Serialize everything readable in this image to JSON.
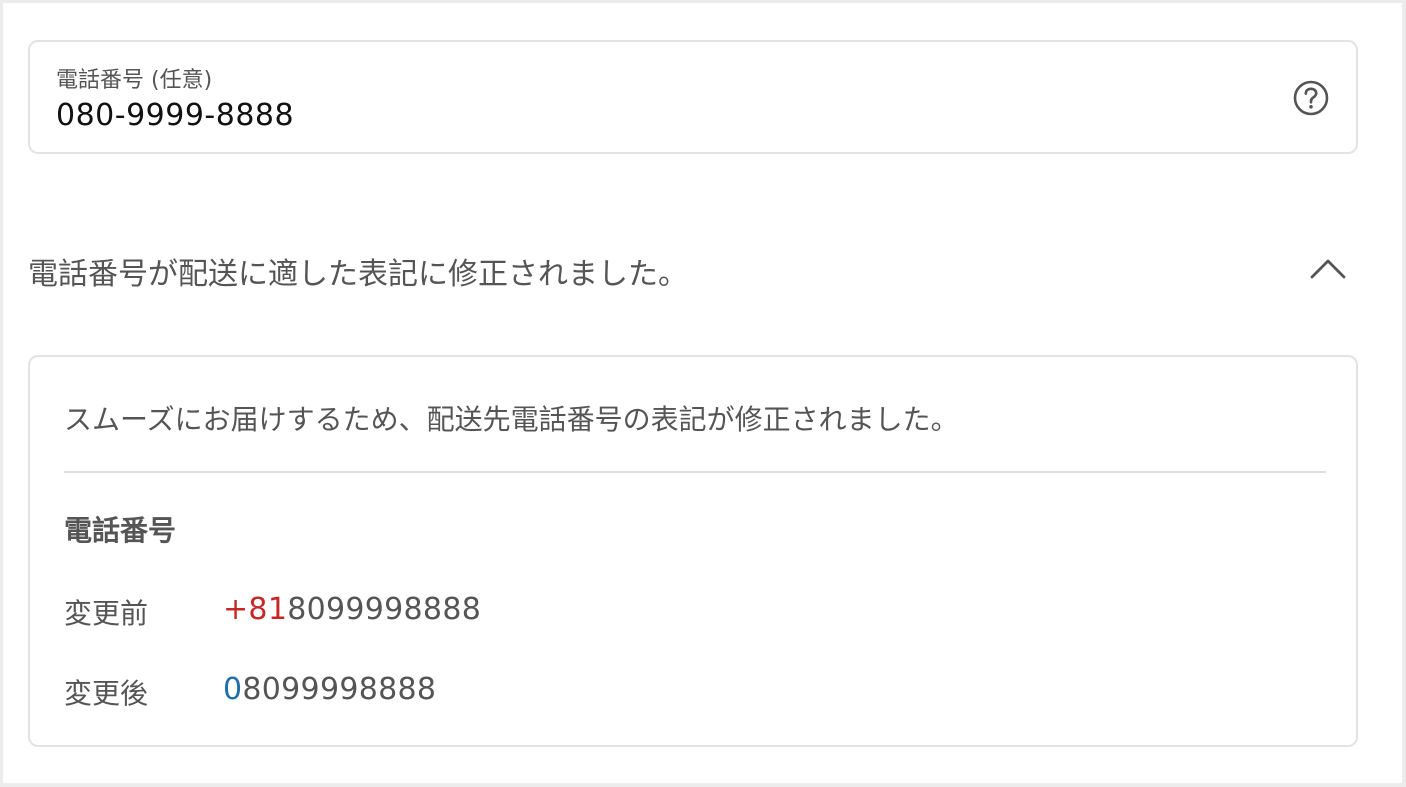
{
  "phone_field": {
    "label": "電話番号 (任意)",
    "value": "080-9999-8888",
    "help_icon": "question-circle-icon"
  },
  "notice": {
    "title": "電話番号が配送に適した表記に修正されました。",
    "toggle_icon": "chevron-up-icon",
    "expanded": true
  },
  "detail": {
    "message": "スムーズにお届けするため、配送先電話番号の表記が修正されました。",
    "heading": "電話番号",
    "before": {
      "label": "変更前",
      "highlight": "+81",
      "rest": "8099998888"
    },
    "after": {
      "label": "変更後",
      "highlight": "0",
      "rest": "8099998888"
    }
  },
  "colors": {
    "removed_highlight": "#c62828",
    "added_highlight": "#1f6fa8",
    "text": "#555555",
    "border": "#e3e3e3"
  }
}
